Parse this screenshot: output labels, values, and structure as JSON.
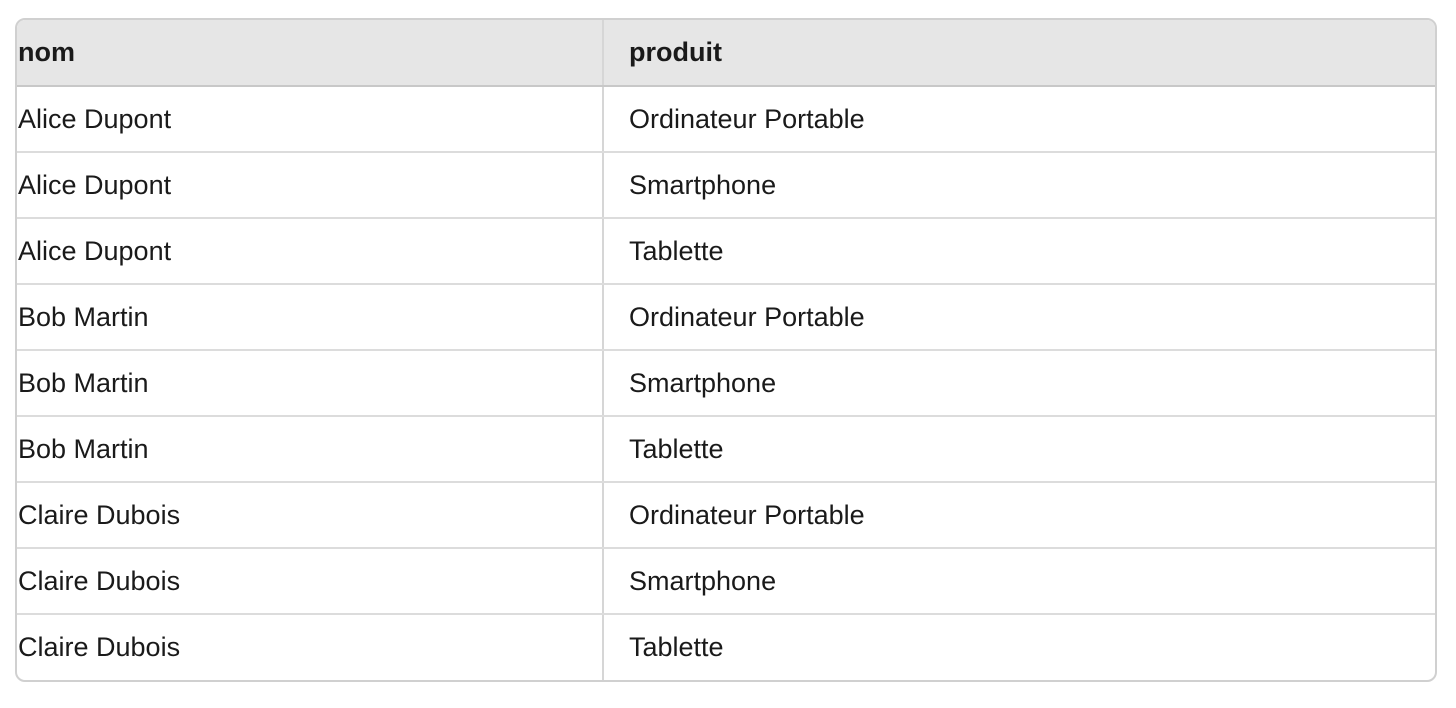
{
  "table": {
    "columns": [
      "nom",
      "produit"
    ],
    "rows": [
      [
        "Alice Dupont",
        "Ordinateur Portable"
      ],
      [
        "Alice Dupont",
        "Smartphone"
      ],
      [
        "Alice Dupont",
        "Tablette"
      ],
      [
        "Bob Martin",
        "Ordinateur Portable"
      ],
      [
        "Bob Martin",
        "Smartphone"
      ],
      [
        "Bob Martin",
        "Tablette"
      ],
      [
        "Claire Dubois",
        "Ordinateur Portable"
      ],
      [
        "Claire Dubois",
        "Smartphone"
      ],
      [
        "Claire Dubois",
        "Tablette"
      ]
    ]
  },
  "colors": {
    "header_background": "#e6e6e6",
    "border": "#d0d0d0",
    "text": "#1a1a1a"
  }
}
